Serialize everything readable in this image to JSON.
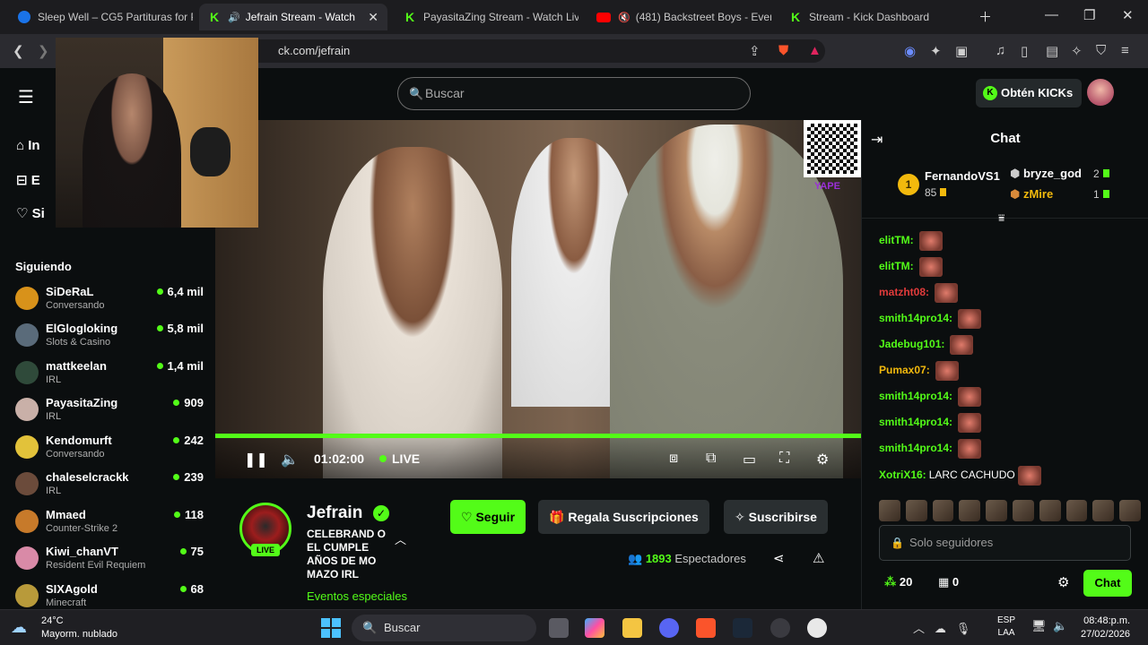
{
  "browser": {
    "tabs": [
      {
        "label": "Sleep Well – CG5 Partituras for Pia",
        "icon": "cg-favicon",
        "active": false
      },
      {
        "label": "Jefrain Stream - Watch Live",
        "icon": "kick-favicon",
        "active": true,
        "audio": true
      },
      {
        "label": "PayasitaZing Stream - Watch Live",
        "icon": "kick-favicon",
        "active": false
      },
      {
        "label": "(481) Backstreet Boys - Everyb",
        "icon": "youtube-favicon",
        "active": false,
        "muted": true
      },
      {
        "label": "Stream - Kick Dashboard",
        "icon": "kick-favicon",
        "active": false
      }
    ],
    "url": "ck.com/jefrain",
    "brave_badge": "1"
  },
  "header": {
    "search_placeholder": "Buscar",
    "kicks_button": "Obtén KICKs"
  },
  "sidebar": {
    "nav": [
      "In",
      "E",
      "Si"
    ],
    "following_title": "Siguiendo",
    "channels": [
      {
        "name": "SiDeRaL",
        "category": "Conversando",
        "viewers": "6,4 mil",
        "color": "#d8921a"
      },
      {
        "name": "ElGlogloking",
        "category": "Slots & Casino",
        "viewers": "5,8 mil",
        "color": "#5a6b7a"
      },
      {
        "name": "mattkeelan",
        "category": "IRL",
        "viewers": "1,4 mil",
        "color": "#2f4a3a"
      },
      {
        "name": "PayasitaZing",
        "category": "IRL",
        "viewers": "909",
        "color": "#c9b0a8"
      },
      {
        "name": "Kendomurft",
        "category": "Conversando",
        "viewers": "242",
        "color": "#e2c23a"
      },
      {
        "name": "chaleselcrackk",
        "category": "IRL",
        "viewers": "239",
        "color": "#6b4b3b"
      },
      {
        "name": "Mmaed",
        "category": "Counter-Strike 2",
        "viewers": "118",
        "color": "#c77a2a"
      },
      {
        "name": "Kiwi_chanVT",
        "category": "Resident Evil Requiem",
        "viewers": "75",
        "color": "#d98aa7"
      },
      {
        "name": "SIXAgold",
        "category": "Minecraft",
        "viewers": "68",
        "color": "#b89a3a"
      }
    ]
  },
  "player": {
    "time": "01:02:00",
    "live_label": "LIVE",
    "qr_caption": "YAPE"
  },
  "streamer": {
    "name": "Jefrain",
    "live_badge": "LIVE",
    "title": "CELEBRAND O EL CUMPLE AÑOS DE MO MAZO IRL",
    "category": "Eventos especiales",
    "follow_label": "Seguir",
    "gift_label": "Regala Suscripciones",
    "subscribe_label": "Suscribirse",
    "viewers_count": "1893",
    "viewers_label": "Espectadores"
  },
  "chat": {
    "title": "Chat",
    "leaderboard": {
      "first": {
        "rank": "1",
        "name": "FernandoVS1",
        "amount": "85"
      },
      "second": {
        "name": "bryze_god",
        "amount": "2"
      },
      "third": {
        "name": "zMire",
        "amount": "1"
      }
    },
    "messages": [
      {
        "user": "elitTM:",
        "text": "",
        "color": "#53fc18"
      },
      {
        "user": "elitTM:",
        "text": "",
        "color": "#53fc18"
      },
      {
        "user": "matzht08:",
        "text": "",
        "color": "#e23b3b"
      },
      {
        "user": "smith14pro14:",
        "text": "",
        "color": "#53fc18"
      },
      {
        "user": "Jadebug101:",
        "text": "",
        "color": "#53fc18"
      },
      {
        "user": "Pumax07:",
        "text": "",
        "color": "#f2b90d"
      },
      {
        "user": "smith14pro14:",
        "text": "",
        "color": "#53fc18"
      },
      {
        "user": "smith14pro14:",
        "text": "",
        "color": "#53fc18"
      },
      {
        "user": "smith14pro14:",
        "text": "",
        "color": "#53fc18"
      },
      {
        "user": "XotriX16:",
        "text": "LARC CACHUDO",
        "color": "#53fc18"
      }
    ],
    "input_placeholder": "Solo seguidores",
    "kicks_count": "20",
    "gifts_count": "0",
    "send_label": "Chat"
  },
  "taskbar": {
    "temperature": "24°C",
    "weather": "Mayorm. nublado",
    "search_label": "Buscar",
    "lang_line1": "ESP",
    "lang_line2": "LAA",
    "time": "08:48:p.m.",
    "date": "27/02/2026"
  }
}
